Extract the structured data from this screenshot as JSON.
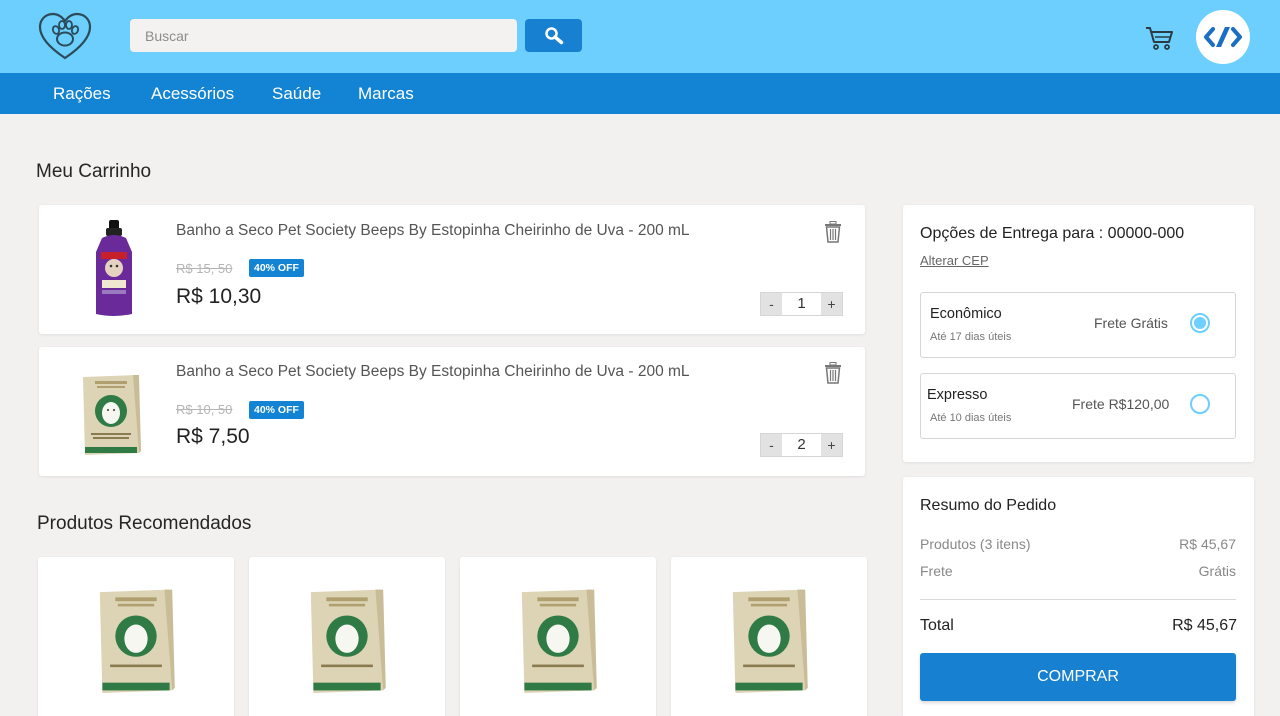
{
  "header": {
    "search_placeholder": "Buscar",
    "logo_icon": "paw-heart-icon",
    "cart_icon": "cart-icon",
    "avatar_icon": "avatar-icon"
  },
  "nav": {
    "items": [
      {
        "label": "Rações"
      },
      {
        "label": "Acessórios"
      },
      {
        "label": "Saúde"
      },
      {
        "label": "Marcas"
      }
    ]
  },
  "cart": {
    "title": "Meu Carrinho",
    "items": [
      {
        "name": "Banho a Seco Pet Society Beeps By Estopinha Cheirinho de Uva - 200 mL",
        "old_price": "R$ 15, 50",
        "discount": "40% OFF",
        "price": "R$ 10,30",
        "qty": "1",
        "qty_minus": "-",
        "qty_plus": "+",
        "image": "purple-bottle"
      },
      {
        "name": "Banho a Seco Pet Society Beeps By Estopinha Cheirinho de Uva - 200 mL",
        "old_price": "R$ 10, 50",
        "discount": "40% OFF",
        "price": "R$ 7,50",
        "qty": "2",
        "qty_minus": "-",
        "qty_plus": "+",
        "image": "soap-box"
      }
    ]
  },
  "delivery": {
    "title": "Opções de Entrega para : 00000-000",
    "change_cep": "Alterar CEP",
    "options": [
      {
        "name": "Econômico",
        "time": "Até 17 dias úteis",
        "price": "Frete Grátis",
        "selected": true
      },
      {
        "name": "Expresso",
        "time": "Até 10 dias úteis",
        "price": "Frete R$120,00",
        "selected": false
      }
    ]
  },
  "summary": {
    "title": "Resumo do Pedido",
    "products_label": "Produtos (3 itens)",
    "products_value": "R$ 45,67",
    "shipping_label": "Frete",
    "shipping_value": "Grátis",
    "total_label": "Total",
    "total_value": "R$ 45,67",
    "buy_label": "COMPRAR"
  },
  "recommended": {
    "title": "Produtos Recomendados",
    "items": [
      {
        "image": "soap-box"
      },
      {
        "image": "soap-box"
      },
      {
        "image": "soap-box"
      },
      {
        "image": "soap-box"
      }
    ]
  },
  "colors": {
    "header_bg": "#6ccffd",
    "nav_bg": "#1384d3",
    "primary_button": "#1780d0",
    "radio_accent": "#6ccffd",
    "page_bg": "#f2f1f0"
  }
}
